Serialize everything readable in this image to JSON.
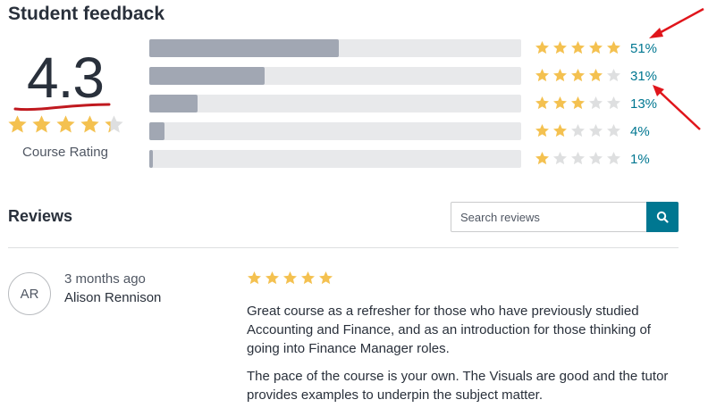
{
  "feedback": {
    "title": "Student feedback",
    "average_rating": "4.3",
    "average_rating_stars": 4.3,
    "caption": "Course Rating",
    "distribution": [
      {
        "stars": 5,
        "percent_label": "51%",
        "fraction": 0.51
      },
      {
        "stars": 4,
        "percent_label": "31%",
        "fraction": 0.31
      },
      {
        "stars": 3,
        "percent_label": "13%",
        "fraction": 0.13
      },
      {
        "stars": 2,
        "percent_label": "4%",
        "fraction": 0.04
      },
      {
        "stars": 1,
        "percent_label": "1%",
        "fraction": 0.01
      }
    ]
  },
  "reviews": {
    "title": "Reviews",
    "search_placeholder": "Search reviews",
    "search_icon": "search-icon",
    "items": [
      {
        "avatar_initials": "AR",
        "time": "3 months ago",
        "author": "Alison Rennison",
        "rating": 5,
        "paragraphs": [
          "Great course as a refresher for those who have previously studied Accounting and Finance, and as an introduction for those thinking of going into Finance Manager roles.",
          "The pace of the course is your own. The Visuals are good and the tutor provides examples to underpin the subject matter."
        ]
      }
    ]
  },
  "colors": {
    "star_filled": "#f4c150",
    "star_empty": "#dedfe0",
    "bar_fill": "#a1a7b3",
    "bar_track": "#e8e9eb",
    "accent": "#007791",
    "annotation_red": "#e0151b",
    "underline_red": "#c0191f"
  }
}
